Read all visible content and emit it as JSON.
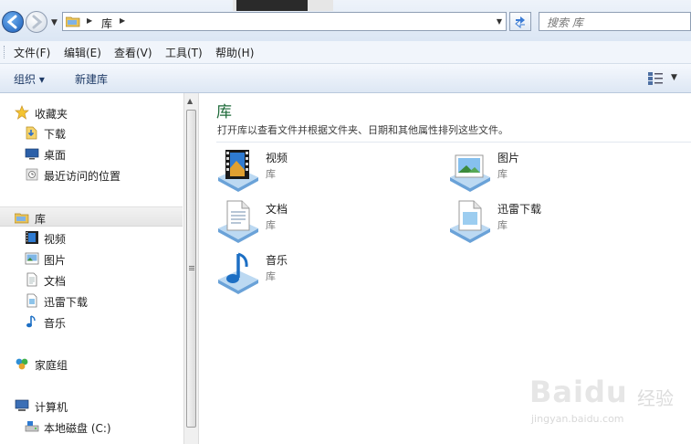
{
  "address_bar": {
    "path": "库",
    "search_placeholder": "搜索 库"
  },
  "menu": {
    "items": [
      "文件(F)",
      "编辑(E)",
      "查看(V)",
      "工具(T)",
      "帮助(H)"
    ]
  },
  "command_bar": {
    "organize": "组织 ▾",
    "new_library": "新建库"
  },
  "nav": {
    "favorites": "收藏夹",
    "downloads": "下载",
    "desktop": "桌面",
    "recent": "最近访问的位置",
    "libraries": "库",
    "videos": "视频",
    "pictures": "图片",
    "documents": "文档",
    "xunlei": "迅雷下载",
    "music": "音乐",
    "homegroup": "家庭组",
    "computer": "计算机",
    "local_disk": "本地磁盘 (C:)"
  },
  "content": {
    "title": "库",
    "description": "打开库以查看文件并根据文件夹、日期和其他属性排列这些文件。",
    "items": [
      {
        "name": "视频",
        "type": "库"
      },
      {
        "name": "图片",
        "type": "库"
      },
      {
        "name": "文档",
        "type": "库"
      },
      {
        "name": "迅雷下载",
        "type": "库"
      },
      {
        "name": "音乐",
        "type": "库"
      }
    ]
  },
  "watermark": {
    "brand": "Baidu",
    "brand_cn": "经验",
    "url": "jingyan.baidu.com"
  },
  "colors": {
    "title_green": "#1e6a39",
    "nav_selected": "#e5e5e5",
    "toolbar_blue": "#dde7f4"
  }
}
